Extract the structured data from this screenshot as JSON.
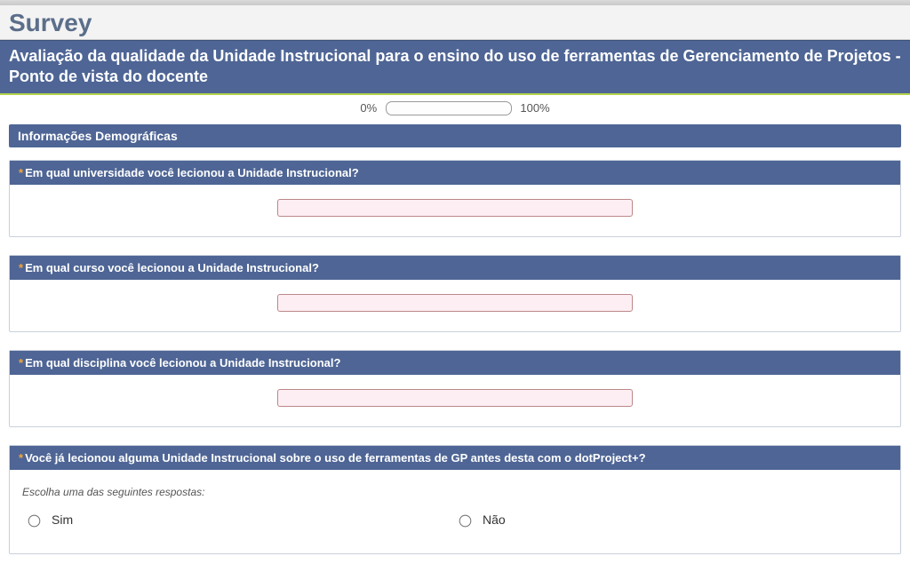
{
  "page_title": "Survey",
  "survey_title": "Avaliação da qualidade da Unidade Instrucional para o ensino do uso de ferramentas de Gerenciamento de Projetos - Ponto de vista do docente",
  "progress": {
    "left_label": "0%",
    "right_label": "100%"
  },
  "section_header": "Informações Demográficas",
  "required_marker": "*",
  "questions": {
    "q1": {
      "text": "Em qual universidade você lecionou a Unidade Instrucional?",
      "value": ""
    },
    "q2": {
      "text": "Em qual curso você lecionou a Unidade Instrucional?",
      "value": ""
    },
    "q3": {
      "text": "Em qual disciplina você lecionou a Unidade Instrucional?",
      "value": ""
    },
    "q4": {
      "text": "Você já lecionou alguma Unidade Instrucional sobre o uso de ferramentas de GP antes desta com o dotProject+?",
      "hint": "Escolha uma das seguintes respostas:",
      "options": {
        "yes": "Sim",
        "no": "Não"
      }
    }
  }
}
